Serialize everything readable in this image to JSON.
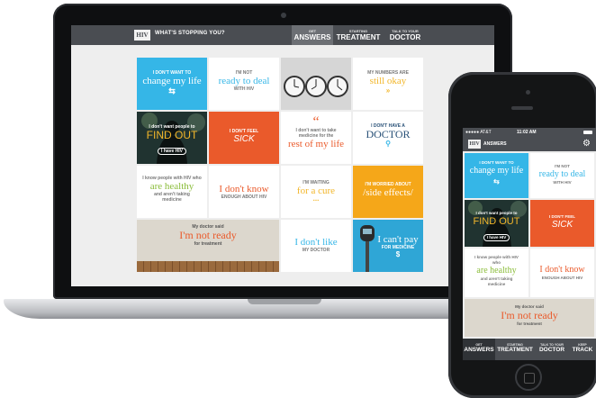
{
  "laptop": {
    "header": {
      "logo": "HIV",
      "title": "WHAT'S STOPPING YOU?",
      "tabs": [
        {
          "small": "GET",
          "big": "ANSWERS"
        },
        {
          "small": "STARTING",
          "big": "TREATMENT"
        },
        {
          "small": "TALK TO YOUR",
          "big": "DOCTOR"
        }
      ]
    },
    "tiles": {
      "change_life": {
        "small": "I DON'T WANT TO",
        "big": "change my life",
        "icon": "⇆"
      },
      "ready_deal": {
        "small": "I'M NOT",
        "big": "ready to deal",
        "small2": "WITH HIV"
      },
      "numbers": {
        "small": "MY NUMBERS ARE",
        "big": "still okay",
        "icon": "»"
      },
      "find_out": {
        "small": "I don't want people to",
        "big": "FIND OUT",
        "tag": "I have HIV"
      },
      "sick": {
        "small": "I DON'T FEEL",
        "big": "SICK"
      },
      "medicine": {
        "quote": "“",
        "small": "I don't want to take medicine for the",
        "big": "rest of my life"
      },
      "doctor": {
        "small": "I DON'T HAVE A",
        "big": "DOCTOR",
        "icon": "⚲"
      },
      "healthy": {
        "small": "I know people with HIV who",
        "big": "are healthy",
        "small2": "and aren't taking medicine"
      },
      "dont_know": {
        "big": "I don't know",
        "small": "ENOUGH ABOUT HIV"
      },
      "cure": {
        "small": "I'M WAITING",
        "big": "for a cure",
        "dots": "..."
      },
      "side_effects": {
        "small": "I'M WORRIED ABOUT",
        "big": "/side effects/"
      },
      "not_ready": {
        "small": "My doctor said",
        "big": "I'm not ready",
        "small2": "for treatment"
      },
      "dont_like": {
        "big": "I don't like",
        "small": "MY DOCTOR"
      },
      "cant_pay": {
        "big": "I can't pay",
        "small": "FOR MEDICINE",
        "icon": "$"
      }
    }
  },
  "phone": {
    "status": {
      "carrier": "●●●●● AT&T",
      "time": "11:02 AM"
    },
    "header": {
      "logo": "HIV",
      "title": "ANSWERS",
      "icon": "gear-icon"
    },
    "tiles": {
      "change_life": {
        "small": "I DON'T WANT TO",
        "big": "change my life",
        "icon": "⇆"
      },
      "ready_deal": {
        "small": "I'M NOT",
        "big": "ready to deal",
        "small2": "WITH HIV"
      },
      "find_out": {
        "small": "I don't want people to",
        "big": "FIND OUT",
        "tag": "I have HIV"
      },
      "sick": {
        "small": "I DON'T FEEL",
        "big": "SICK"
      },
      "healthy": {
        "small": "I know people with HIV who",
        "big": "are healthy",
        "small2": "and aren't taking medicine"
      },
      "dont_know": {
        "big": "I don't know",
        "small": "ENOUGH ABOUT HIV"
      },
      "not_ready": {
        "small": "My doctor said",
        "big": "I'm not ready",
        "small2": "for treatment"
      }
    },
    "tabs": [
      {
        "small": "GET",
        "big": "ANSWERS"
      },
      {
        "small": "STARTING",
        "big": "TREATMENT"
      },
      {
        "small": "TALK TO YOUR",
        "big": "DOCTOR"
      },
      {
        "small": "KEEP",
        "big": "TRACK"
      }
    ]
  },
  "colors": {
    "blue": "#35b6e7",
    "orange": "#ea5a2b",
    "yellow": "#f5a719",
    "green": "#8bbd3b",
    "header": "#4a4d52"
  }
}
